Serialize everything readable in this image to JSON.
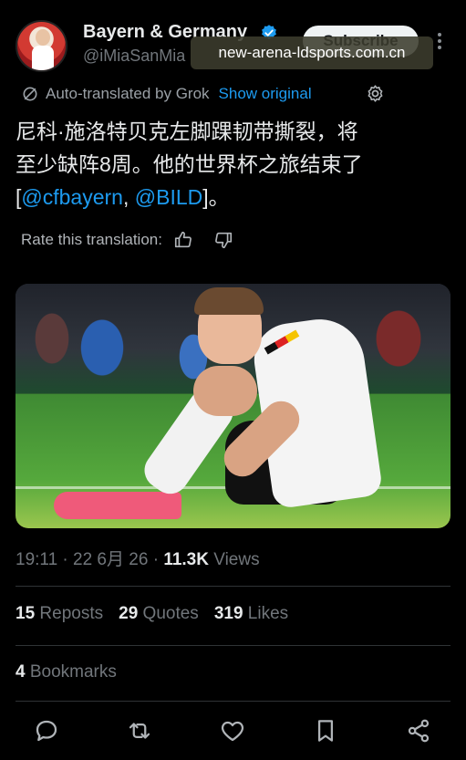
{
  "header": {
    "display_name": "Bayern & Germany",
    "handle": "@iMiaSanMia",
    "subscribe_label": "Subscribe"
  },
  "watermark": "new-arena-ldsports.com.cn",
  "translation": {
    "auto_translated_label": "Auto-translated by Grok",
    "show_original_label": "Show original",
    "rate_label": "Rate this translation:"
  },
  "tweet": {
    "text_line1": "尼科·施洛特贝克左脚踝韧带撕裂，将",
    "text_line2": "至少缺阵8周。他的世界杯之旅结束了",
    "bracket_open": "[",
    "mention1": "@cfbayern",
    "separator": ", ",
    "mention2": "@BILD",
    "bracket_close": "]。"
  },
  "meta": {
    "time_date": "19:11 · 22 6月 26 · ",
    "views_count": "11.3K",
    "views_label": " Views"
  },
  "stats": {
    "reposts_count": "15",
    "reposts_label": " Reposts",
    "quotes_count": "29",
    "quotes_label": " Quotes",
    "likes_count": "319",
    "likes_label": " Likes",
    "bookmarks_count": "4",
    "bookmarks_label": " Bookmarks"
  },
  "colors": {
    "background": "#000000",
    "link": "#1d9bf0",
    "secondary_text": "#71767b",
    "verified": "#1d9bf0"
  },
  "icons": [
    "verified-badge-icon",
    "more-icon",
    "translate-icon",
    "settings-icon",
    "thumbs-up-icon",
    "thumbs-down-icon",
    "reply-icon",
    "repost-icon",
    "like-icon",
    "bookmark-icon",
    "share-icon"
  ]
}
